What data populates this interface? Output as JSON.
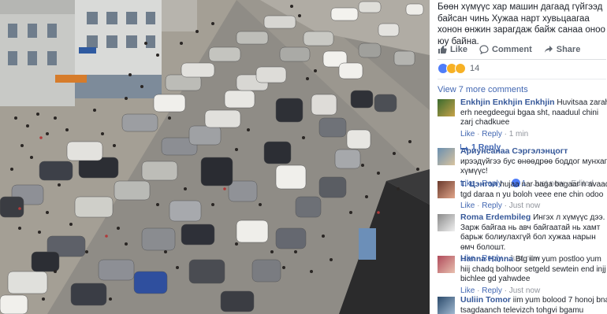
{
  "post": {
    "caption": "Бөөн хүмүүс хар машин дагаад гүйгээд байсан чинь Хужаа нарт хувьцаагаа хонон өнжин зарагдаж байж санаа оноо юу байна.",
    "actions": {
      "like": "Like",
      "comment": "Comment",
      "share": "Share"
    },
    "reaction_count": "14",
    "view_more": "View 7 more comments"
  },
  "comments": [
    {
      "name": "Enkhjin Enkhjin Enkhjin",
      "text": "Huvitsaa zarah erh neegdeegui bgaa sht, naaduul chini zarj chadkuee",
      "like": "Like",
      "reply": "Reply",
      "time": "1 min",
      "replies": "1 Reply"
    },
    {
      "name": "Ариунсанаа Сэргэлэнцогт",
      "text": "ирээдүйгээ бус өнөөдрөө боддог мунхаг хүмүүс!",
      "like": "Like",
      "reply": "Reply",
      "likes": "1",
      "time": "Just now",
      "edited": "Edited"
    },
    {
      "name": "T. Цэнгэл",
      "text": "hujaa nar baga bagaar n avaad tgd daraa n yu boloh veee ene chin odoo",
      "like": "Like",
      "reply": "Reply",
      "time": "Just now"
    },
    {
      "name": "Roma Erdembileg",
      "text": "Ингэх л хүмүүс дээ. Зарж байгаа нь авч байгаатай нь хамт барьж болиулахгүй бол хужаа нарын өмч болошт.",
      "like": "Like",
      "reply": "Reply",
      "time": "Just now"
    },
    {
      "name": "Hanna Hanna",
      "text": "Btg iim yum postloo yum hiij chadq bolhoor setgeld sewtein end injj bichlee gd yahwdee",
      "like": "Like",
      "reply": "Reply",
      "time": "Just now"
    },
    {
      "name": "Uuliin Tomor",
      "text": "iim yum bolood 7 honoj bna tsagdaanch televizch tohgvi bgamu itgehgvi bgam"
    }
  ],
  "icons": {
    "like": "thumbs-up-icon",
    "comment": "speech-bubble-icon",
    "share": "share-arrow-icon",
    "reply": "reply-arrow-icon"
  },
  "colors": {
    "link": "#365899",
    "meta": "#90949c",
    "like_blue": "#4f7df9"
  }
}
